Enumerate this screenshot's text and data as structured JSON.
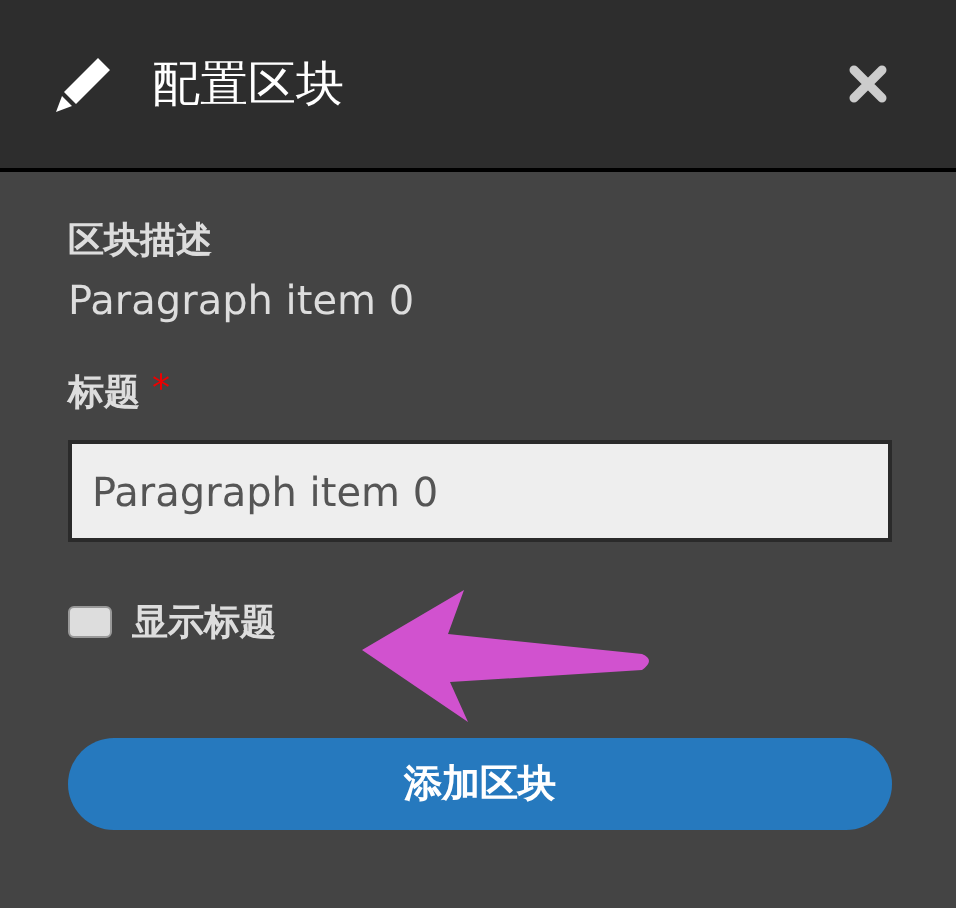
{
  "dialog": {
    "title": "配置区块"
  },
  "description": {
    "label": "区块描述",
    "value": "Paragraph item 0"
  },
  "title_field": {
    "label": "标题",
    "required_mark": "*",
    "value": "Paragraph item 0"
  },
  "show_title": {
    "label": "显示标题",
    "checked": false
  },
  "submit": {
    "label": "添加区块"
  }
}
